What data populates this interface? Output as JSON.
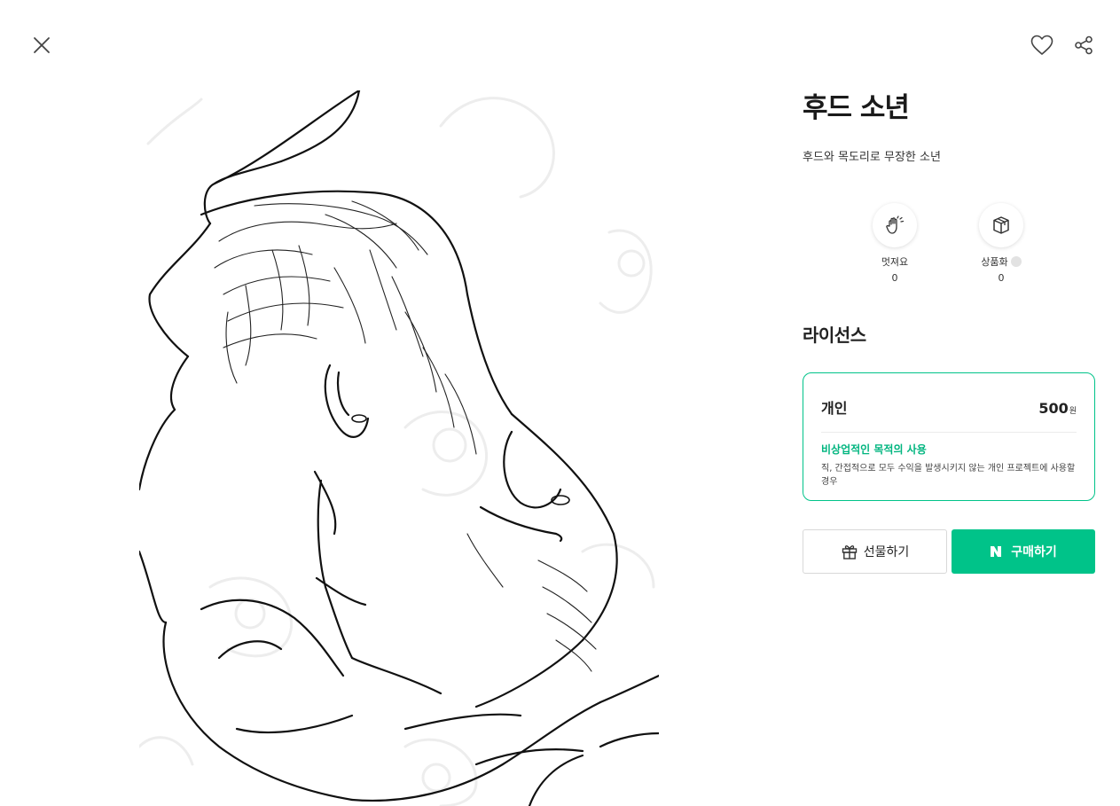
{
  "topbar": {
    "close_icon": "close-icon",
    "like_icon": "heart-outline-icon",
    "share_icon": "share-icon"
  },
  "artwork": {
    "subject": "line-art",
    "background": "#ffffff"
  },
  "product": {
    "title": "후드 소년",
    "description": "후드와 목도리로 무장한 소년"
  },
  "stats": [
    {
      "label": "멋져요",
      "count": "0",
      "icon": "clap-icon"
    },
    {
      "label": "상품화",
      "count": "0",
      "icon": "box-icon"
    }
  ],
  "license": {
    "heading": "라이선스",
    "card": {
      "name": "개인",
      "price": "500",
      "currency": "원",
      "type": "비상업적인 목적의 사용",
      "note": "직, 간접적으로 모두 수익을 발생시키지 않는 개인 프로젝트에 사용할 경우"
    }
  },
  "actions": {
    "gift_label": "선물하기",
    "buy_label": "구매하기"
  },
  "colors": {
    "accent": "#00c389",
    "accent_text": "#00b57f"
  }
}
